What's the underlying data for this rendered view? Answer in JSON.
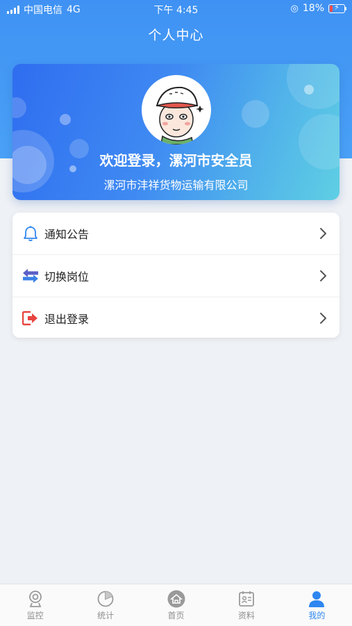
{
  "status_bar": {
    "carrier": "中国电信",
    "network": "4G",
    "time": "下午 4:45",
    "battery_percent": "18%"
  },
  "header": {
    "title": "个人中心"
  },
  "profile": {
    "avatar_icon": "cartoon-avatar-icon",
    "welcome_text": "欢迎登录，漯河市安全员",
    "company": "漯河市沣祥货物运输有限公司"
  },
  "menu": {
    "items": [
      {
        "label": "通知公告",
        "icon": "bell-icon"
      },
      {
        "label": "切换岗位",
        "icon": "swap-arrows-icon"
      },
      {
        "label": "退出登录",
        "icon": "logout-icon"
      }
    ]
  },
  "tabbar": {
    "tabs": [
      {
        "label": "监控",
        "icon": "camera-icon",
        "active": false
      },
      {
        "label": "统计",
        "icon": "pie-chart-icon",
        "active": false
      },
      {
        "label": "首页",
        "icon": "home-icon",
        "active": false
      },
      {
        "label": "资料",
        "icon": "id-card-icon",
        "active": false
      },
      {
        "label": "我的",
        "icon": "user-icon",
        "active": true
      }
    ]
  },
  "colors": {
    "primary": "#2f86f0",
    "header_bg": "#4aa1f6",
    "page_bg": "#eef1f5",
    "logout_red": "#e8443f",
    "swap_purple": "#5b5fc7"
  }
}
